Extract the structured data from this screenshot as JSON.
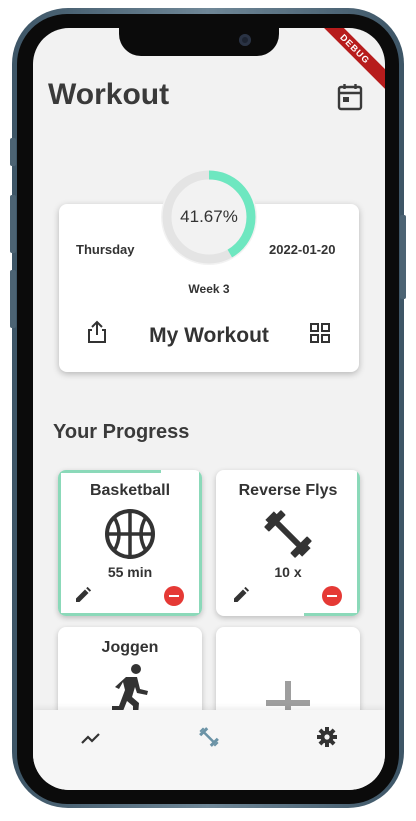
{
  "app": {
    "title": "Workout"
  },
  "debug_banner": "DEBUG",
  "workout_card": {
    "day": "Thursday",
    "date": "2022-01-20",
    "progress_text": "41.67%",
    "progress_fraction": 0.4167,
    "week": "Week 3",
    "name": "My Workout"
  },
  "progress_section": {
    "title": "Your Progress",
    "tiles": [
      {
        "name": "Basketball",
        "value": "55 min",
        "icon": "basketball-icon"
      },
      {
        "name": "Reverse Flys",
        "value": "10 x",
        "icon": "dumbbell-icon"
      },
      {
        "name": "Joggen",
        "value": "",
        "icon": "running-icon"
      }
    ],
    "add_tile_icon": "plus-icon"
  },
  "nav": {
    "items": [
      "trending-icon",
      "fitness-icon",
      "settings-icon"
    ]
  },
  "colors": {
    "accent": "#6ee7c0",
    "accent_soft": "#8bd9b9",
    "remove": "#e53935",
    "nav_active": "#6b93a6"
  }
}
